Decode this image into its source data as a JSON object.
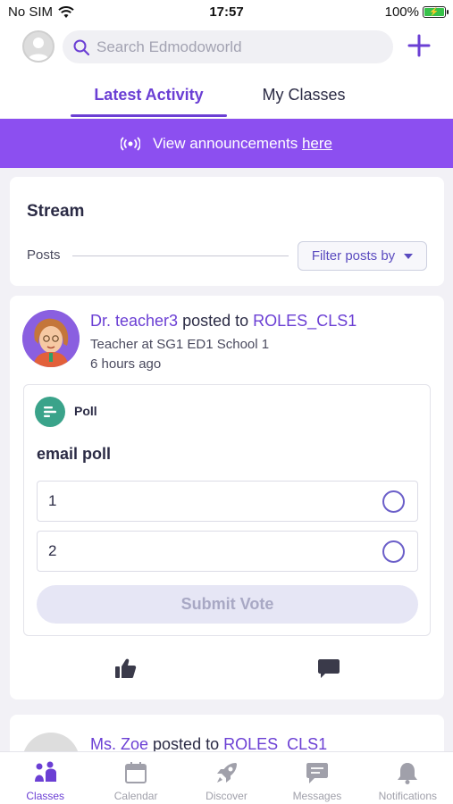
{
  "status_bar": {
    "carrier": "No SIM",
    "time": "17:57",
    "battery": "100%"
  },
  "header": {
    "search_placeholder": "Search Edmodoworld"
  },
  "tabs": [
    {
      "label": "Latest Activity",
      "active": true
    },
    {
      "label": "My Classes",
      "active": false
    }
  ],
  "banner": {
    "text": "View announcements",
    "link": "here"
  },
  "stream": {
    "title": "Stream",
    "posts_label": "Posts",
    "filter_label": "Filter posts by"
  },
  "posts": [
    {
      "author": "Dr. teacher3",
      "verb": "posted to",
      "target": "ROLES_CLS1",
      "subtitle": "Teacher at SG1 ED1 School 1",
      "time": "6 hours ago",
      "poll": {
        "label": "Poll",
        "question": "email poll",
        "options": [
          "1",
          "2"
        ],
        "submit_label": "Submit Vote"
      }
    },
    {
      "author": "Ms. Zoe",
      "verb": "posted to",
      "target": "ROLES_CLS1"
    }
  ],
  "bottom_nav": [
    {
      "label": "Classes",
      "icon": "classes-icon",
      "active": true
    },
    {
      "label": "Calendar",
      "icon": "calendar-icon",
      "active": false
    },
    {
      "label": "Discover",
      "icon": "rocket-icon",
      "active": false
    },
    {
      "label": "Messages",
      "icon": "chat-icon",
      "active": false
    },
    {
      "label": "Notifications",
      "icon": "bell-icon",
      "active": false
    }
  ],
  "colors": {
    "accent": "#6b3fd4",
    "banner": "#8c4ff0",
    "poll_icon": "#3aa38a"
  }
}
